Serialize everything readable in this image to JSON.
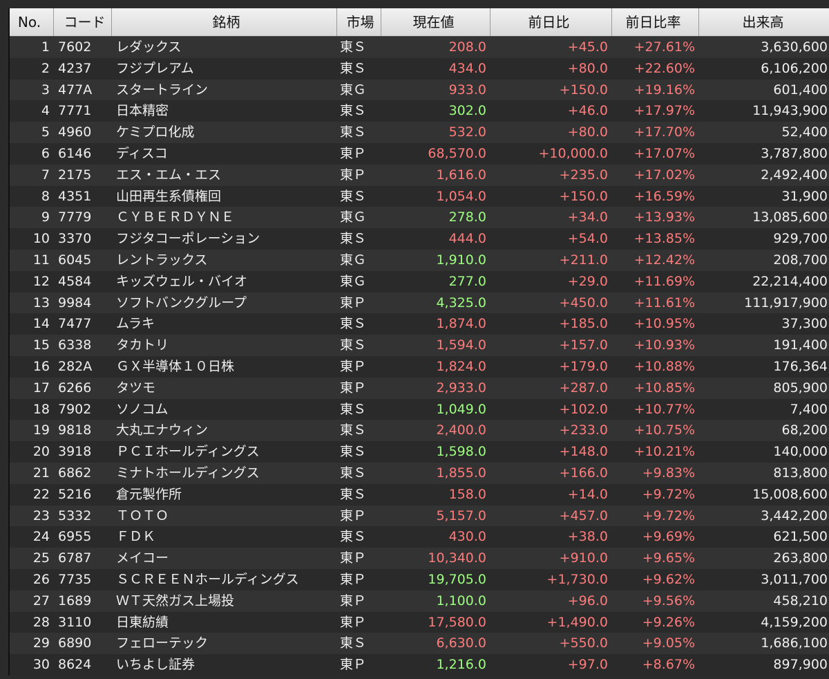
{
  "colors": {
    "up_red": "#ff7b7b",
    "green": "#9dff7f",
    "text": "#efefef",
    "bg": "#2b2b2b"
  },
  "headers": {
    "no": "No.",
    "code": "コード",
    "name": "銘柄",
    "market": "市場",
    "price": "現在値",
    "change": "前日比",
    "change_pct": "前日比率",
    "volume": "出来高"
  },
  "rows": [
    {
      "no": "1",
      "code": "7602",
      "name": "レダックス",
      "market": "東Ｓ",
      "price": "208.0",
      "price_color": "red",
      "change": "+45.0",
      "change_pct": "+27.61%",
      "volume": "3,630,600"
    },
    {
      "no": "2",
      "code": "4237",
      "name": "フジプレアム",
      "market": "東Ｓ",
      "price": "434.0",
      "price_color": "red",
      "change": "+80.0",
      "change_pct": "+22.60%",
      "volume": "6,106,200"
    },
    {
      "no": "3",
      "code": "477A",
      "name": "スタートライン",
      "market": "東Ｇ",
      "price": "933.0",
      "price_color": "red",
      "change": "+150.0",
      "change_pct": "+19.16%",
      "volume": "601,400"
    },
    {
      "no": "4",
      "code": "7771",
      "name": "日本精密",
      "market": "東Ｓ",
      "price": "302.0",
      "price_color": "green",
      "change": "+46.0",
      "change_pct": "+17.97%",
      "volume": "11,943,900"
    },
    {
      "no": "5",
      "code": "4960",
      "name": "ケミプロ化成",
      "market": "東Ｓ",
      "price": "532.0",
      "price_color": "red",
      "change": "+80.0",
      "change_pct": "+17.70%",
      "volume": "52,400"
    },
    {
      "no": "6",
      "code": "6146",
      "name": "ディスコ",
      "market": "東Ｐ",
      "price": "68,570.0",
      "price_color": "red",
      "change": "+10,000.0",
      "change_pct": "+17.07%",
      "volume": "3,787,800"
    },
    {
      "no": "7",
      "code": "2175",
      "name": "エス・エム・エス",
      "market": "東Ｐ",
      "price": "1,616.0",
      "price_color": "red",
      "change": "+235.0",
      "change_pct": "+17.02%",
      "volume": "2,492,400"
    },
    {
      "no": "8",
      "code": "4351",
      "name": "山田再生系債権回",
      "market": "東Ｓ",
      "price": "1,054.0",
      "price_color": "red",
      "change": "+150.0",
      "change_pct": "+16.59%",
      "volume": "31,900"
    },
    {
      "no": "9",
      "code": "7779",
      "name": "ＣＹＢＥＲＤＹＮＥ",
      "market": "東Ｇ",
      "price": "278.0",
      "price_color": "green",
      "change": "+34.0",
      "change_pct": "+13.93%",
      "volume": "13,085,600"
    },
    {
      "no": "10",
      "code": "3370",
      "name": "フジタコーポレーション",
      "market": "東Ｓ",
      "price": "444.0",
      "price_color": "red",
      "change": "+54.0",
      "change_pct": "+13.85%",
      "volume": "929,700"
    },
    {
      "no": "11",
      "code": "6045",
      "name": "レントラックス",
      "market": "東Ｇ",
      "price": "1,910.0",
      "price_color": "green",
      "change": "+211.0",
      "change_pct": "+12.42%",
      "volume": "208,700"
    },
    {
      "no": "12",
      "code": "4584",
      "name": "キッズウェル・バイオ",
      "market": "東Ｇ",
      "price": "277.0",
      "price_color": "green",
      "change": "+29.0",
      "change_pct": "+11.69%",
      "volume": "22,214,400"
    },
    {
      "no": "13",
      "code": "9984",
      "name": "ソフトバンクグループ",
      "market": "東Ｐ",
      "price": "4,325.0",
      "price_color": "green",
      "change": "+450.0",
      "change_pct": "+11.61%",
      "volume": "111,917,900"
    },
    {
      "no": "14",
      "code": "7477",
      "name": "ムラキ",
      "market": "東Ｓ",
      "price": "1,874.0",
      "price_color": "red",
      "change": "+185.0",
      "change_pct": "+10.95%",
      "volume": "37,300"
    },
    {
      "no": "15",
      "code": "6338",
      "name": "タカトリ",
      "market": "東Ｓ",
      "price": "1,594.0",
      "price_color": "red",
      "change": "+157.0",
      "change_pct": "+10.93%",
      "volume": "191,400"
    },
    {
      "no": "16",
      "code": "282A",
      "name": "ＧＸ半導体１０日株",
      "market": "東Ｐ",
      "price": "1,824.0",
      "price_color": "red",
      "change": "+179.0",
      "change_pct": "+10.88%",
      "volume": "176,364"
    },
    {
      "no": "17",
      "code": "6266",
      "name": "タツモ",
      "market": "東Ｐ",
      "price": "2,933.0",
      "price_color": "red",
      "change": "+287.0",
      "change_pct": "+10.85%",
      "volume": "805,900"
    },
    {
      "no": "18",
      "code": "7902",
      "name": "ソノコム",
      "market": "東Ｓ",
      "price": "1,049.0",
      "price_color": "green",
      "change": "+102.0",
      "change_pct": "+10.77%",
      "volume": "7,400"
    },
    {
      "no": "19",
      "code": "9818",
      "name": "大丸エナウィン",
      "market": "東Ｓ",
      "price": "2,400.0",
      "price_color": "red",
      "change": "+233.0",
      "change_pct": "+10.75%",
      "volume": "68,200"
    },
    {
      "no": "20",
      "code": "3918",
      "name": "ＰＣＩホールディングス",
      "market": "東Ｓ",
      "price": "1,598.0",
      "price_color": "green",
      "change": "+148.0",
      "change_pct": "+10.21%",
      "volume": "140,000"
    },
    {
      "no": "21",
      "code": "6862",
      "name": "ミナトホールディングス",
      "market": "東Ｓ",
      "price": "1,855.0",
      "price_color": "red",
      "change": "+166.0",
      "change_pct": "+9.83%",
      "volume": "813,800"
    },
    {
      "no": "22",
      "code": "5216",
      "name": "倉元製作所",
      "market": "東Ｓ",
      "price": "158.0",
      "price_color": "red",
      "change": "+14.0",
      "change_pct": "+9.72%",
      "volume": "15,008,600"
    },
    {
      "no": "23",
      "code": "5332",
      "name": "ＴＯＴＯ",
      "market": "東Ｐ",
      "price": "5,157.0",
      "price_color": "red",
      "change": "+457.0",
      "change_pct": "+9.72%",
      "volume": "3,442,200"
    },
    {
      "no": "24",
      "code": "6955",
      "name": "ＦＤＫ",
      "market": "東Ｓ",
      "price": "430.0",
      "price_color": "red",
      "change": "+38.0",
      "change_pct": "+9.69%",
      "volume": "621,500"
    },
    {
      "no": "25",
      "code": "6787",
      "name": "メイコー",
      "market": "東Ｐ",
      "price": "10,340.0",
      "price_color": "red",
      "change": "+910.0",
      "change_pct": "+9.65%",
      "volume": "263,800"
    },
    {
      "no": "26",
      "code": "7735",
      "name": "ＳＣＲＥＥＮホールディングス",
      "market": "東Ｐ",
      "price": "19,705.0",
      "price_color": "green",
      "change": "+1,730.0",
      "change_pct": "+9.62%",
      "volume": "3,011,700"
    },
    {
      "no": "27",
      "code": "1689",
      "name": "ＷＴ天然ガス上場投",
      "market": "東Ｐ",
      "price": "1,100.0",
      "price_color": "green",
      "change": "+96.0",
      "change_pct": "+9.56%",
      "volume": "458,210"
    },
    {
      "no": "28",
      "code": "3110",
      "name": "日東紡績",
      "market": "東Ｐ",
      "price": "17,580.0",
      "price_color": "red",
      "change": "+1,490.0",
      "change_pct": "+9.26%",
      "volume": "4,159,200"
    },
    {
      "no": "29",
      "code": "6890",
      "name": "フェローテック",
      "market": "東Ｓ",
      "price": "6,630.0",
      "price_color": "red",
      "change": "+550.0",
      "change_pct": "+9.05%",
      "volume": "1,686,100"
    },
    {
      "no": "30",
      "code": "8624",
      "name": "いちよし証券",
      "market": "東Ｐ",
      "price": "1,216.0",
      "price_color": "green",
      "change": "+97.0",
      "change_pct": "+8.67%",
      "volume": "897,900"
    }
  ]
}
